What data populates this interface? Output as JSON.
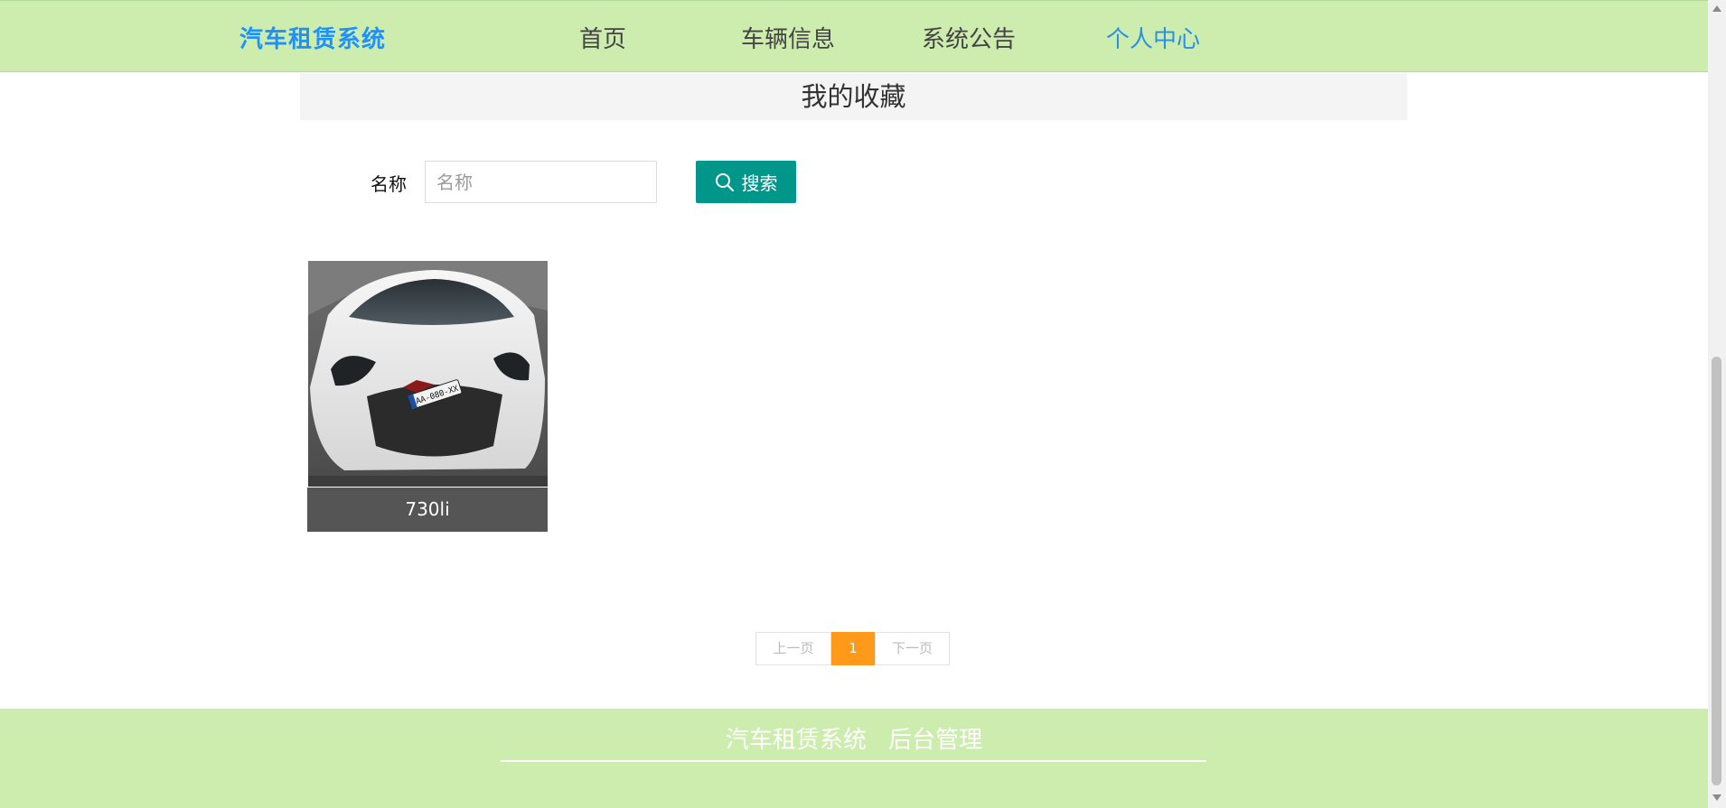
{
  "header": {
    "brand": "汽车租赁系统",
    "nav": [
      {
        "label": "首页"
      },
      {
        "label": "车辆信息"
      },
      {
        "label": "系统公告"
      },
      {
        "label": "个人中心",
        "active": true
      }
    ]
  },
  "page_title": "我的收藏",
  "search": {
    "label": "名称",
    "placeholder": "名称",
    "value": "",
    "button_label": "搜索",
    "button_icon": "search-icon"
  },
  "favorites": [
    {
      "name": "730li",
      "image": "white-sports-car-photo"
    }
  ],
  "pagination": {
    "prev_label": "上一页",
    "current_page": "1",
    "next_label": "下一页"
  },
  "footer": {
    "links": [
      {
        "label": "汽车租赁系统"
      },
      {
        "label": "后台管理"
      }
    ]
  },
  "colors": {
    "header_bg": "#ccedad",
    "brand": "#1e90ff",
    "nav_active": "#2b8fe6",
    "search_button": "#00968a",
    "page_active": "#ff991a",
    "caption_bg": "#555555"
  }
}
